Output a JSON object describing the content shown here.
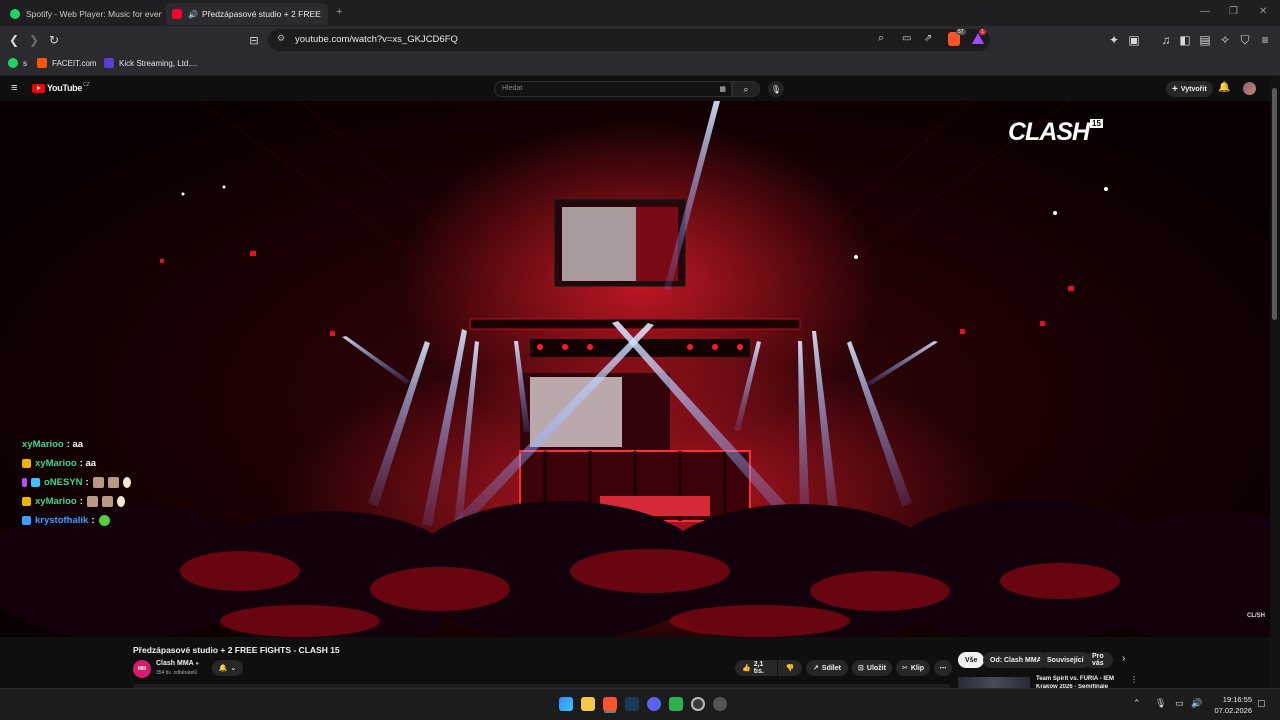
{
  "browser": {
    "tabs": [
      {
        "title": "Spotify - Web Player: Music for every",
        "favicon": "spotify-icon",
        "active": false
      },
      {
        "title": "Předzápasové studio + 2 FREE",
        "favicon": "youtube-icon",
        "active": true
      }
    ],
    "new_tab_label": "+",
    "url": "youtube.com/watch?v=xs_GKJCD6FQ",
    "brave_badge": "57",
    "rewards_badge": "1"
  },
  "bookmarks": [
    {
      "label": "s",
      "icon": "spotify-icon"
    },
    {
      "label": "FACEIT.com",
      "icon": "faceit-icon"
    },
    {
      "label": "Kick Streaming, Ltd....",
      "icon": "kick-icon"
    }
  ],
  "youtube": {
    "logo_text": "YouTube",
    "country_code": "CZ",
    "search_placeholder": "Hledat",
    "create_label": "Vytvořit",
    "video": {
      "watermark": "CLASH",
      "watermark_number": "15",
      "corner_watermark": "CL/SH",
      "chat": [
        {
          "user": "xyMarioo",
          "message": ": aa",
          "color": "#3dd68c",
          "badge": "none",
          "emotes": 0
        },
        {
          "user": "xyMarioo",
          "message": ": aa",
          "color": "#3dd68c",
          "badge": "crown",
          "emotes": 0
        },
        {
          "user": "oNESYN",
          "message": ":",
          "color": "#3dd68c",
          "badge": "mic",
          "emotes": 3
        },
        {
          "user": "xyMarioo",
          "message": ":",
          "color": "#3dd68c",
          "badge": "crown",
          "emotes": 3
        },
        {
          "user": "krystofhalik",
          "message": ":",
          "color": "#3aa0ff",
          "badge": "share",
          "emotes": 1
        }
      ]
    },
    "title": "Předzápasové studio + 2 FREE FIGHTS - CLASH 15",
    "channel": {
      "name": "Clash MMA",
      "subscribers": "354 tis. odběratelů",
      "avatar_text": "MM"
    },
    "actions": {
      "likes": "2,1 tis.",
      "share": "Sdílet",
      "save": "Uložit",
      "clip": "Klip"
    },
    "chips": [
      "Vše",
      "Od: Clash MMA",
      "Související",
      "Pro vás"
    ],
    "related": {
      "title": "Team Spirit vs. FURIA - IEM",
      "subtitle": "Kraków 2026 - Semifinále"
    }
  },
  "taskbar": {
    "time": "19:16:55",
    "date": "07.02.2026"
  },
  "colors": {
    "accent_red": "#ff0000",
    "brave_orange": "#fb542b"
  }
}
